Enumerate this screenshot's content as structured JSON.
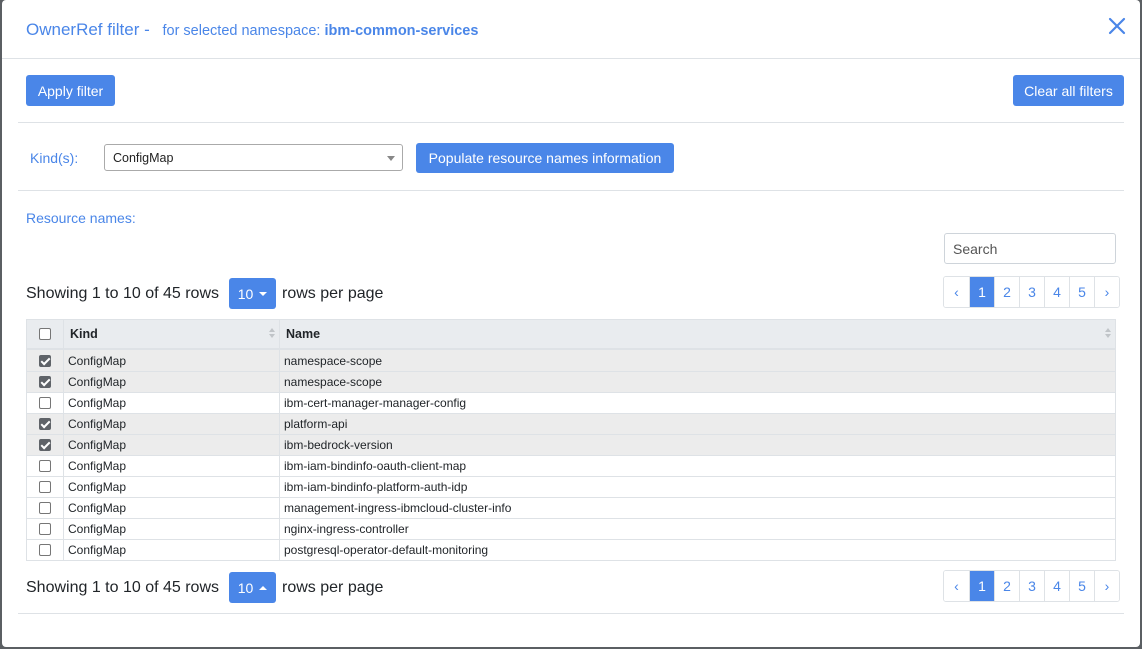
{
  "header": {
    "title": "OwnerRef filter -",
    "subtitle_prefix": "for selected namespace:",
    "namespace": "ibm-common-services"
  },
  "toolbar": {
    "apply_label": "Apply filter",
    "clear_label": "Clear all filters"
  },
  "kinds": {
    "label": "Kind(s):",
    "selected": "ConfigMap",
    "populate_label": "Populate resource names information"
  },
  "resources": {
    "label": "Resource names:",
    "search_placeholder": "Search"
  },
  "pager": {
    "info": "Showing 1 to 10 of 45 rows",
    "page_size": "10",
    "suffix": "rows per page",
    "prev": "‹",
    "next": "›",
    "pages": [
      "1",
      "2",
      "3",
      "4",
      "5"
    ],
    "active_page": "1"
  },
  "table": {
    "columns": [
      "Kind",
      "Name"
    ],
    "rows": [
      {
        "checked": true,
        "kind": "ConfigMap",
        "name": "namespace-scope"
      },
      {
        "checked": true,
        "kind": "ConfigMap",
        "name": "namespace-scope"
      },
      {
        "checked": false,
        "kind": "ConfigMap",
        "name": "ibm-cert-manager-manager-config"
      },
      {
        "checked": true,
        "kind": "ConfigMap",
        "name": "platform-api"
      },
      {
        "checked": true,
        "kind": "ConfigMap",
        "name": "ibm-bedrock-version"
      },
      {
        "checked": false,
        "kind": "ConfigMap",
        "name": "ibm-iam-bindinfo-oauth-client-map"
      },
      {
        "checked": false,
        "kind": "ConfigMap",
        "name": "ibm-iam-bindinfo-platform-auth-idp"
      },
      {
        "checked": false,
        "kind": "ConfigMap",
        "name": "management-ingress-ibmcloud-cluster-info"
      },
      {
        "checked": false,
        "kind": "ConfigMap",
        "name": "nginx-ingress-controller"
      },
      {
        "checked": false,
        "kind": "ConfigMap",
        "name": "postgresql-operator-default-monitoring"
      }
    ]
  },
  "colors": {
    "accent": "#4a86e8",
    "selected_row": "#ececec"
  }
}
